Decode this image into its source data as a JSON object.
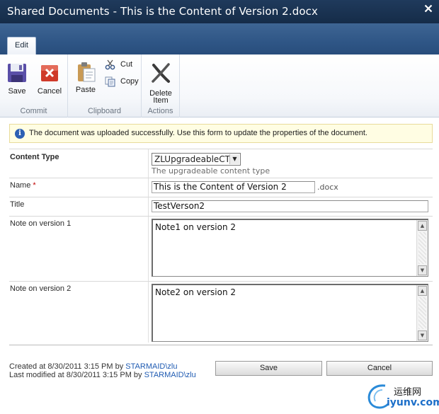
{
  "window": {
    "title": "Shared Documents - This is the Content of Version 2.docx"
  },
  "ribbon": {
    "tab_label": "Edit",
    "groups": {
      "commit": {
        "label": "Commit",
        "save": "Save",
        "cancel": "Cancel"
      },
      "clipboard": {
        "label": "Clipboard",
        "paste": "Paste",
        "cut": "Cut",
        "copy": "Copy"
      },
      "actions": {
        "label": "Actions",
        "delete_line1": "Delete",
        "delete_line2": "Item"
      }
    }
  },
  "info": {
    "message": "The document was uploaded successfully. Use this form to update the properties of the document."
  },
  "form": {
    "content_type": {
      "label": "Content Type",
      "value": "ZLUpgradeableCT",
      "description": "The upgradeable content type"
    },
    "name": {
      "label": "Name",
      "required_mark": "*",
      "value": "This is the Content of Version 2",
      "suffix": ".docx"
    },
    "title": {
      "label": "Title",
      "value": "TestVerson2"
    },
    "note1": {
      "label": "Note on version 1",
      "value": "Note1  on version 2"
    },
    "note2": {
      "label": "Note on version 2",
      "value": "Note2 on version 2"
    }
  },
  "footer": {
    "created_prefix": "Created at 8/30/2011 3:15 PM  by ",
    "created_by": "STARMAID\\zlu",
    "modified_prefix": "Last modified at 8/30/2011 3:15 PM  by ",
    "modified_by": "STARMAID\\zlu",
    "save_button": "Save",
    "cancel_button": "Cancel"
  },
  "watermark": {
    "line1": "运维网",
    "line2": "iyunv.com"
  },
  "colors": {
    "title_bar": "#1f3a5c",
    "ribbon_tabs": "#2f5686",
    "info_bg": "#fffde3",
    "link": "#1f5bb2",
    "required": "#bf0000"
  }
}
